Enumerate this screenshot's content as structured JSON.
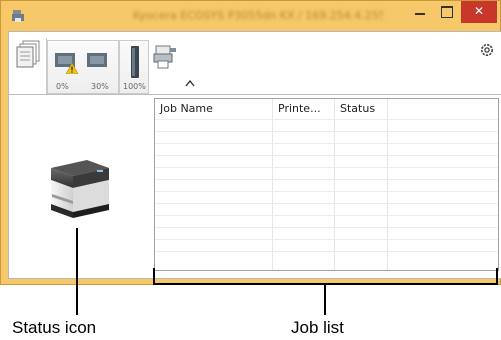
{
  "window": {
    "title": "Kyocera ECOSYS P3055dn KX / 169.254.4.255",
    "accent_color": "#f6c869",
    "close_color": "#c7382b"
  },
  "toolbar": {
    "tray_levels": [
      "0%",
      "30%"
    ],
    "toner_level": "100%",
    "icons": [
      "document-stack-icon",
      "paper-tray-icon",
      "warning-icon",
      "toner-cartridge-icon",
      "computer-printer-icon",
      "caret-up-icon",
      "settings-gear-icon"
    ]
  },
  "job_list": {
    "columns": [
      "Job Name",
      "Printe...",
      "Status",
      ""
    ],
    "rows": []
  },
  "annotations": {
    "status_icon_label": "Status icon",
    "job_list_label": "Job list"
  }
}
